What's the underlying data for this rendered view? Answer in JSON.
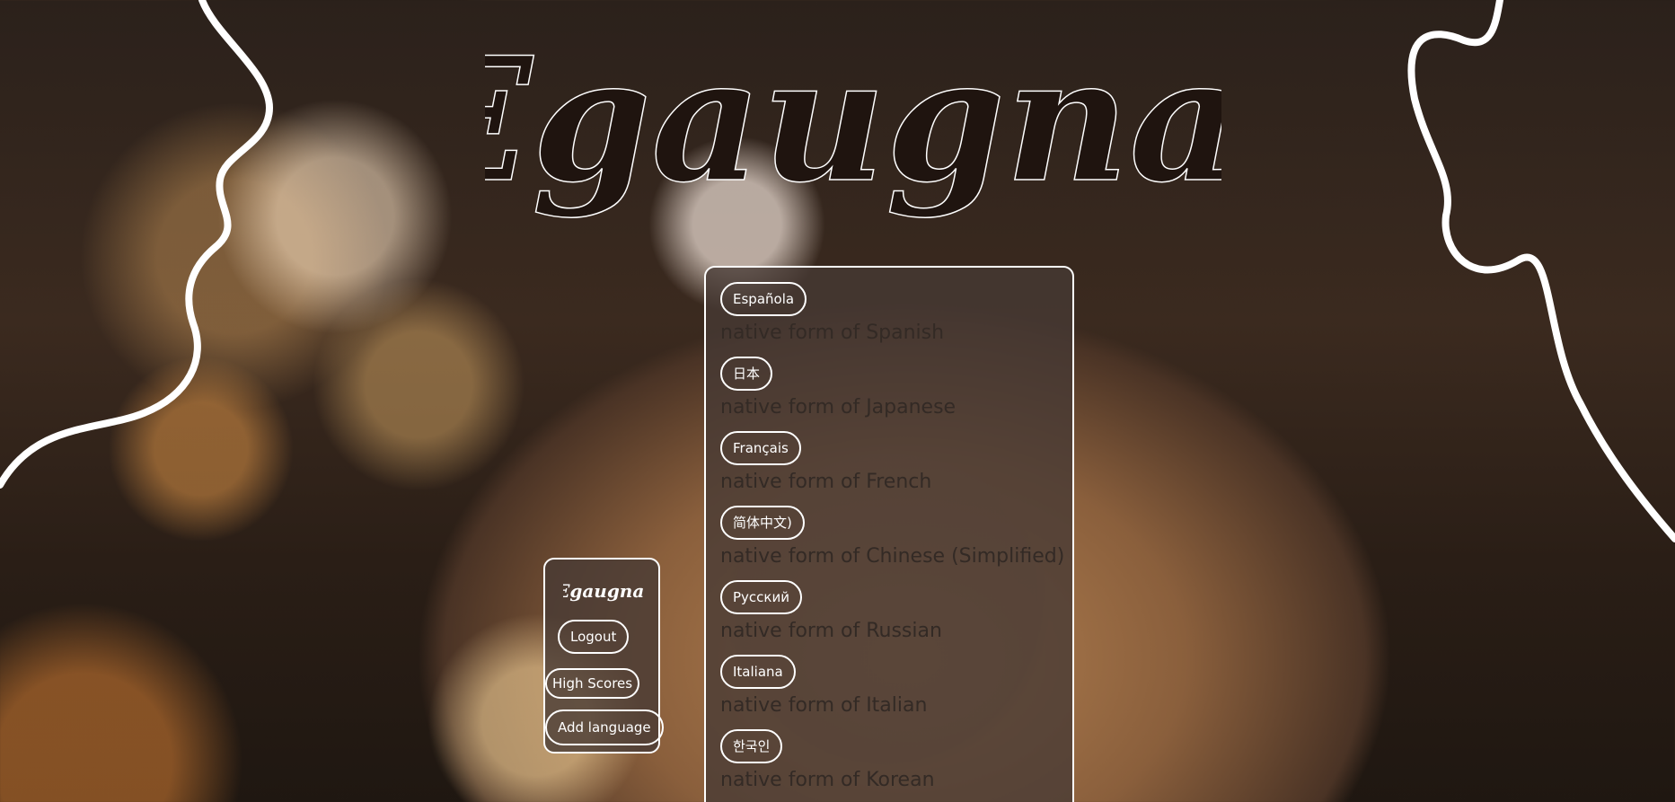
{
  "app": {
    "logo_text": "Egaugnal"
  },
  "languages": [
    {
      "button": "Española",
      "description": "native form of Spanish"
    },
    {
      "button": "日本",
      "description": "native form of Japanese"
    },
    {
      "button": "Français",
      "description": "native form of French"
    },
    {
      "button": "简体中文)",
      "description": "native form of Chinese (Simplified)"
    },
    {
      "button": "Русский",
      "description": "native form of Russian"
    },
    {
      "button": "Italiana",
      "description": "native form of Italian"
    },
    {
      "button": "한국인",
      "description": "native form of Korean"
    }
  ],
  "side_menu": {
    "logo_text": "Egaugnal",
    "logout_label": "Logout",
    "high_scores_label": "High Scores",
    "add_language_label": "Add language"
  },
  "colors": {
    "panel_border": "#ffffff",
    "logo_fill": "#1f140f",
    "description_text": "#332a25"
  }
}
